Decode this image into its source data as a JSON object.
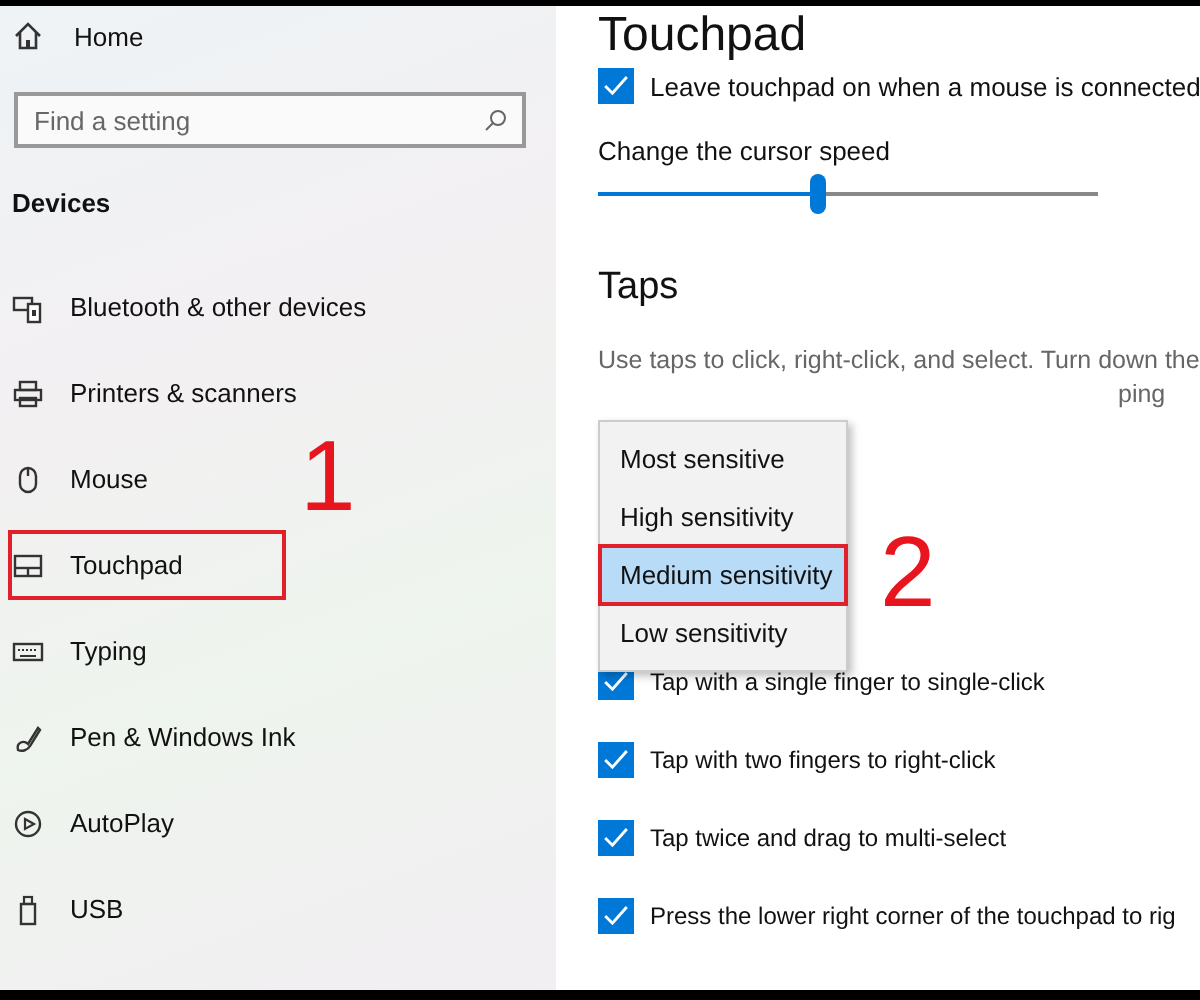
{
  "sidebar": {
    "home": "Home",
    "search": {
      "placeholder": "Find a setting"
    },
    "section": "Devices",
    "items": [
      {
        "label": "Bluetooth & other devices",
        "kind": "bluetooth",
        "highlighted": false
      },
      {
        "label": "Printers & scanners",
        "kind": "printer",
        "highlighted": false
      },
      {
        "label": "Mouse",
        "kind": "mouse",
        "highlighted": false
      },
      {
        "label": "Touchpad",
        "kind": "touchpad",
        "highlighted": true,
        "callout": "1"
      },
      {
        "label": "Typing",
        "kind": "keyboard",
        "highlighted": false
      },
      {
        "label": "Pen & Windows Ink",
        "kind": "pen",
        "highlighted": false
      },
      {
        "label": "AutoPlay",
        "kind": "autoplay",
        "highlighted": false
      },
      {
        "label": "USB",
        "kind": "usb",
        "highlighted": false
      }
    ]
  },
  "content": {
    "title": "Touchpad",
    "leave_on": {
      "label": "Leave touchpad on when a mouse is connected",
      "checked": true
    },
    "cursor_speed": {
      "label": "Change the cursor speed",
      "level": 0.44
    },
    "taps": {
      "heading": "Taps",
      "description": [
        "Use taps to click, right-click, and select. Turn down the",
        "ping"
      ],
      "sensitivity_menu": [
        {
          "label": "Most sensitive",
          "selected": false,
          "highlighted": false
        },
        {
          "label": "High sensitivity",
          "selected": false,
          "highlighted": false
        },
        {
          "label": "Medium sensitivity",
          "selected": true,
          "highlighted": true,
          "callout": "2"
        },
        {
          "label": "Low sensitivity",
          "selected": false,
          "highlighted": false
        }
      ],
      "options": [
        {
          "label": "Tap with a single finger to single-click",
          "checked": true
        },
        {
          "label": "Tap with two fingers to right-click",
          "checked": true
        },
        {
          "label": "Tap twice and drag to multi-select",
          "checked": true
        },
        {
          "label": "Press the lower right corner of the touchpad to rig",
          "checked": true
        }
      ]
    }
  }
}
